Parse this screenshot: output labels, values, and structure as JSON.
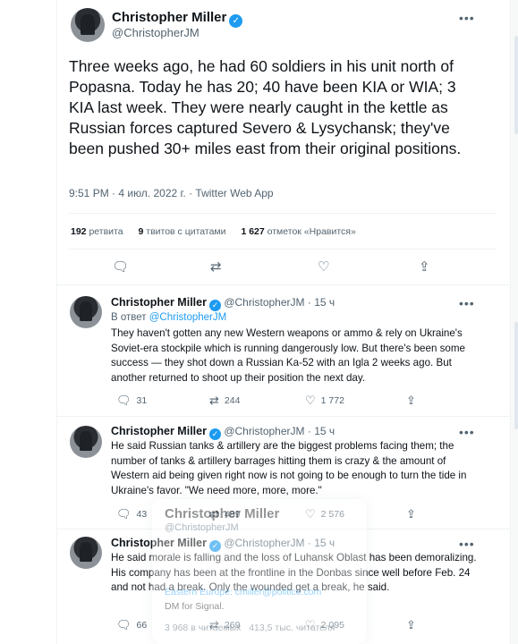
{
  "main_tweet": {
    "name": "Christopher Miller",
    "handle": "@ChristopherJM",
    "text": "Three weeks ago, he had 60 soldiers in his unit north of Popasna. Today he has 20; 40 have been KIA or WIA; 3 KIA last week. They were nearly caught in the kettle as Russian forces captured Severo & Lysychansk; they've been pushed 30+ miles east from their original positions.",
    "meta": "9:51 PM · 4 июл. 2022 г. · Twitter Web App",
    "stats": {
      "retweets_count": "192",
      "retweets_label": "ретвита",
      "quotes_count": "9",
      "quotes_label": "твитов с цитатами",
      "likes_count": "1 627",
      "likes_label": "отметок «Нравится»"
    },
    "more_icon": "more-horizontal-icon"
  },
  "replies": [
    {
      "name": "Christopher Miller",
      "handle": "@ChristopherJM",
      "time": "· 15 ч",
      "reply_to_prefix": "В ответ",
      "reply_to_handle": "@ChristopherJM",
      "text": "They haven't gotten any new Western weapons or ammo & rely on Ukraine's Soviet-era stockpile which is running dangerously low. But there's been some success — they shot down a Russian Ka-52 with an Igla 2 weeks ago. But another returned to shoot up their position the next day.",
      "replies": "31",
      "retweets": "244",
      "likes": "1 772"
    },
    {
      "name": "Christopher Miller",
      "handle": "@ChristopherJM",
      "time": "· 15 ч",
      "text": "He said Russian tanks & artillery are the biggest problems facing them; the number of tanks & artillery barrages hitting them is crazy & the amount of Western aid being given right now is not going to be enough to turn the tide in Ukraine's favor. \"We need more, more, more.\"",
      "replies": "43",
      "retweets": "489",
      "likes": "2 576"
    },
    {
      "name": "Christopher Miller",
      "handle": "@ChristopherJM",
      "time": "· 15 ч",
      "text": "He said morale is falling and the loss of Luhansk Oblast has been demoralizing. His company has been at the frontline in the Donbas since well before Feb. 24 and not had a break. Only the wounded get a break, he said.",
      "replies": "66",
      "retweets": "269",
      "likes": "2 095"
    }
  ],
  "hover_card": {
    "name": "Christopher Miller",
    "handle": "@ChristopherJM",
    "bio_line1": "Eastern Europe: cmiller@politico.com",
    "bio_line2": "DM for Signal.",
    "following": "3 968",
    "following_label": "в читаемых",
    "followers": "413,5 тыс.",
    "followers_label": "читателя"
  },
  "colors": {
    "accent": "#1d9bf0",
    "text": "#0f1419",
    "muted": "#536471",
    "border": "#eff3f4"
  }
}
